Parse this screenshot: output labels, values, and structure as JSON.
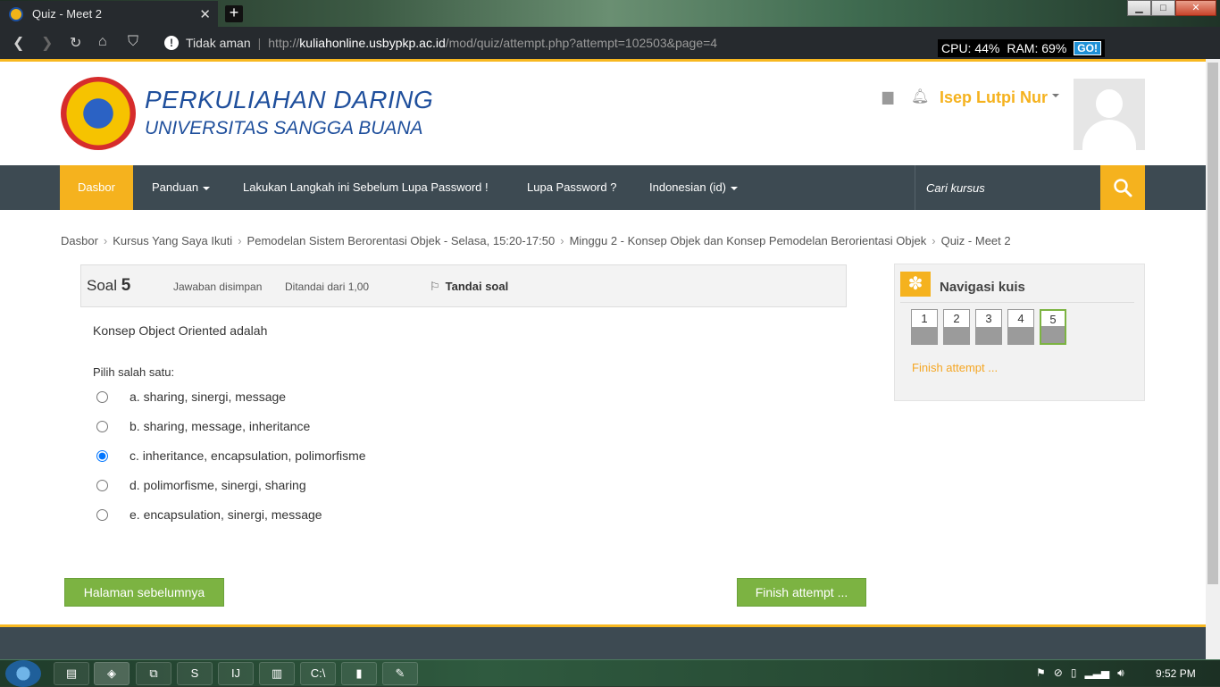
{
  "browser": {
    "tab_title": "Quiz - Meet 2",
    "tab_close": "✕",
    "new_tab": "+",
    "security_label": "Tidak aman",
    "url_prefix": "http://",
    "url_host": "kuliahonline.usbypkp.ac.id",
    "url_path": "/mod/quiz/attempt.php?attempt=102503&page=4",
    "sysmon_cpu": "CPU:  44%",
    "sysmon_ram": "RAM:  69%",
    "sysmon_go": "GO!"
  },
  "site": {
    "title": "PERKULIAHAN DARING",
    "subtitle": "UNIVERSITAS SANGGA BUANA",
    "user_name": "Isep Lutpi Nur"
  },
  "nav": {
    "items": [
      {
        "label": "Dasbor"
      },
      {
        "label": "Panduan"
      },
      {
        "label": "Lakukan Langkah ini Sebelum Lupa Password !"
      },
      {
        "label": "Lupa Password ?"
      },
      {
        "label": "Indonesian (id)"
      }
    ],
    "search_placeholder": "Cari kursus"
  },
  "breadcrumb": [
    "Dasbor",
    "Kursus Yang Saya Ikuti",
    "Pemodelan Sistem Berorentasi Objek - Selasa, 15:20-17:50",
    "Minggu 2 - Konsep Objek dan Konsep Pemodelan Berorientasi Objek",
    "Quiz - Meet 2"
  ],
  "question": {
    "label": "Soal",
    "number": "5",
    "state": "Jawaban disimpan",
    "grade": "Ditandai dari 1,00",
    "flag_label": "Tandai soal",
    "text": "Konsep Object Oriented adalah",
    "prompt": "Pilih salah satu:",
    "answers": [
      "a. sharing, sinergi, message",
      "b. sharing, message, inheritance",
      "c. inheritance, encapsulation, polimorfisme",
      "d. polimorfisme, sinergi, sharing",
      "e. encapsulation, sinergi, message"
    ],
    "selected_index": 2
  },
  "buttons": {
    "prev": "Halaman sebelumnya",
    "finish": "Finish attempt ..."
  },
  "quiz_nav": {
    "title": "Navigasi kuis",
    "questions": [
      "1",
      "2",
      "3",
      "4",
      "5"
    ],
    "current": "5",
    "finish_link": "Finish attempt ..."
  },
  "taskbar": {
    "clock": "9:52 PM"
  },
  "colors": {
    "accent": "#f5b21e",
    "nav_bg": "#3d4a52",
    "button_green": "#7cb342"
  }
}
